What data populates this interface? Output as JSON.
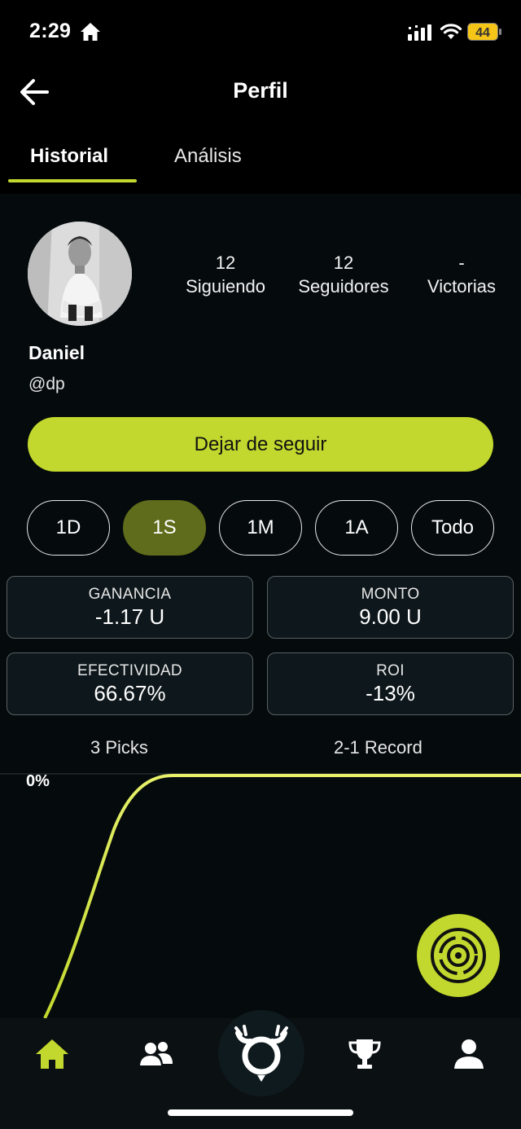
{
  "status_bar": {
    "time": "2:29",
    "battery": "44"
  },
  "header": {
    "title": "Perfil",
    "back_icon": "arrow-left-icon"
  },
  "tabs": [
    {
      "label": "Historial",
      "active": true
    },
    {
      "label": "Análisis",
      "active": false
    }
  ],
  "profile": {
    "name": "Daniel",
    "handle": "@dp",
    "stats": [
      {
        "value": "12",
        "label": "Siguiendo"
      },
      {
        "value": "12",
        "label": "Seguidores"
      },
      {
        "value": "-",
        "label": "Victorias"
      }
    ],
    "follow_button": "Dejar de seguir"
  },
  "ranges": [
    {
      "label": "1D",
      "active": false
    },
    {
      "label": "1S",
      "active": true
    },
    {
      "label": "1M",
      "active": false
    },
    {
      "label": "1A",
      "active": false
    },
    {
      "label": "Todo",
      "active": false
    }
  ],
  "metrics": [
    {
      "label": "GANANCIA",
      "value": "-1.17 U"
    },
    {
      "label": "MONTO",
      "value": "9.00 U"
    },
    {
      "label": "EFECTIVIDAD",
      "value": "66.67%"
    },
    {
      "label": "ROI",
      "value": "-13%"
    }
  ],
  "summary": {
    "picks": "3 Picks",
    "record": "2-1 Record"
  },
  "chart": {
    "y_label": "0%",
    "line_color": "#c2d82e"
  },
  "colors": {
    "accent": "#c2d82e",
    "active_range": "#5f6c1c",
    "background": "#000000"
  },
  "bottom_nav": [
    "home-icon",
    "users-icon",
    "logo-icon",
    "trophy-icon",
    "user-icon"
  ]
}
